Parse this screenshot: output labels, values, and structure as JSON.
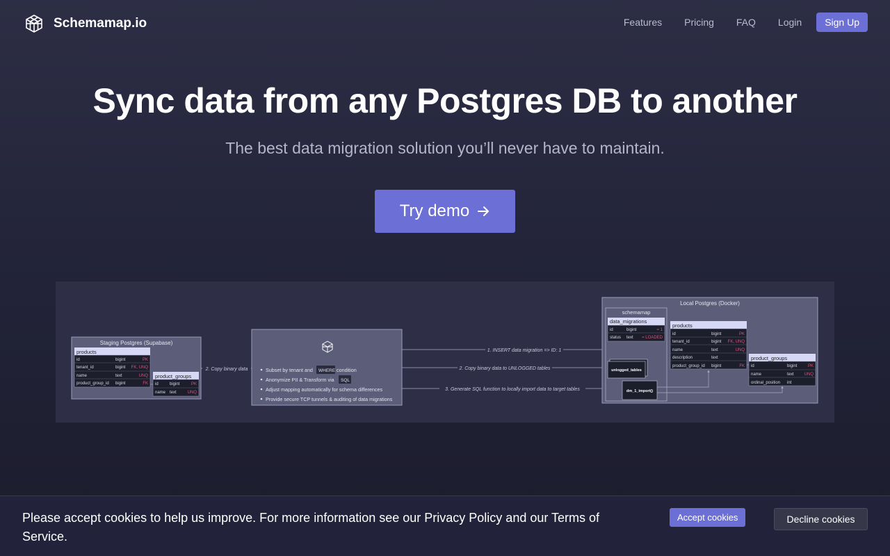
{
  "nav": {
    "brand": "Schemamap.io",
    "links": [
      "Features",
      "Pricing",
      "FAQ",
      "Login"
    ],
    "signup": "Sign Up"
  },
  "hero": {
    "title": "Sync data from any Postgres DB to another",
    "subtitle": "The best data migration solution you’ll never have to maintain.",
    "cta": "Try demo"
  },
  "diagram": {
    "staging": {
      "title": "Staging Postgres (Supabase)",
      "products_table": {
        "name": "products",
        "rows": [
          [
            "id",
            "bigint",
            "PK"
          ],
          [
            "tenant_id",
            "bigint",
            "FK, UNQ"
          ],
          [
            "name",
            "text",
            "UNQ"
          ],
          [
            "product_group_id",
            "bigint",
            "FK"
          ]
        ]
      },
      "groups_table": {
        "name": "product_groups",
        "rows": [
          [
            "id",
            "bigint",
            "PK"
          ],
          [
            "name",
            "text",
            "UNQ"
          ]
        ]
      }
    },
    "copy_label": "2. Copy binary data",
    "center": {
      "b1a": "Subset by tenant and",
      "b1code": "WHERE",
      "b1b": "condition",
      "b2a": "Anonymize PII & Transform via",
      "b2code": "SQL",
      "b3": "Adjust mapping automatically for schema differences",
      "b4": "Provide secure TCP tunnels & auditing of data migrations"
    },
    "arrows": {
      "a1": "1. INSERT data migration => ID: 1",
      "a2": "2. Copy binary data to UNLOGGED tables",
      "a3": "3. Generate SQL function to locally import data to target tables"
    },
    "local": {
      "title": "Local Postgres (Docker)",
      "schema": "schemamap",
      "migrations_table": {
        "name": "data_migrations",
        "rows": [
          [
            "id",
            "bigint",
            "= 1"
          ],
          [
            "status",
            "text",
            "= LOADED"
          ]
        ]
      },
      "unlogged": "unlogged_tables",
      "import_fn": "dm_1_import()",
      "products_table": {
        "name": "products",
        "rows": [
          [
            "id",
            "bigint",
            "PK"
          ],
          [
            "tenant_id",
            "bigint",
            "FK, UNQ"
          ],
          [
            "name",
            "text",
            "UNQ"
          ],
          [
            "description",
            "text",
            ""
          ],
          [
            "product_group_id",
            "bigint",
            "FK"
          ]
        ]
      },
      "groups_table": {
        "name": "product_groups",
        "rows": [
          [
            "id",
            "bigint",
            "PK"
          ],
          [
            "name",
            "text",
            "UNQ"
          ],
          [
            "ordinal_position",
            "int",
            ""
          ]
        ]
      }
    }
  },
  "cookie": {
    "text": "Please accept cookies to help us improve. For more information see our Privacy Policy and our Terms of Service.",
    "accept": "Accept cookies",
    "decline": "Decline cookies"
  },
  "colors": {
    "accent": "#6c70d6",
    "table_header": "#d6d8f5",
    "constraint": "#e0507a"
  }
}
